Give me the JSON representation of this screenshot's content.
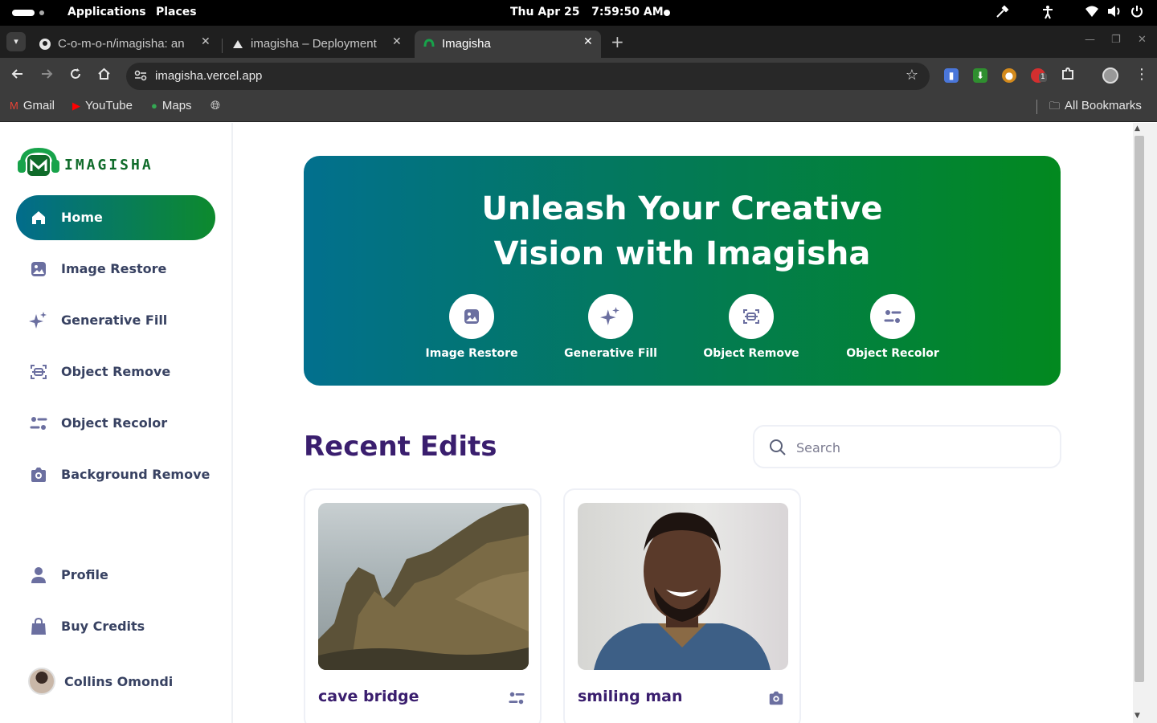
{
  "system_bar": {
    "applications": "Applications",
    "places": "Places",
    "datetime": "Thu Apr 25   7:59:50 AM"
  },
  "browser": {
    "tabs": [
      {
        "title": "C-o-m-o-n/imagisha: an",
        "active": false
      },
      {
        "title": "imagisha – Deployment O",
        "active": false
      },
      {
        "title": "Imagisha",
        "active": true
      }
    ],
    "url": "imagisha.vercel.app",
    "extension_badge": "1",
    "bookmarks": [
      {
        "label": "Gmail"
      },
      {
        "label": "YouTube"
      },
      {
        "label": "Maps"
      }
    ],
    "all_bookmarks": "All Bookmarks"
  },
  "colors": {
    "brand_gradient_start": "#026c8c",
    "brand_gradient_end": "#0d8a2d",
    "heading_purple": "#3a1e6e",
    "nav_text": "#384262"
  },
  "sidebar": {
    "logo_text": "IMAGISHA",
    "items": [
      {
        "label": "Home",
        "icon": "home-icon",
        "active": true
      },
      {
        "label": "Image Restore",
        "icon": "image-icon"
      },
      {
        "label": "Generative Fill",
        "icon": "sparkles-icon"
      },
      {
        "label": "Object Remove",
        "icon": "scan-icon"
      },
      {
        "label": "Object Recolor",
        "icon": "filter-icon"
      },
      {
        "label": "Background Remove",
        "icon": "camera-icon"
      }
    ],
    "bottom_items": [
      {
        "label": "Profile",
        "icon": "user-icon"
      },
      {
        "label": "Buy Credits",
        "icon": "bag-icon"
      }
    ],
    "user_name": "Collins Omondi"
  },
  "hero": {
    "title_line1": "Unleash Your Creative",
    "title_line2": "Vision with Imagisha",
    "links": [
      {
        "label": "Image Restore",
        "icon": "image-icon"
      },
      {
        "label": "Generative Fill",
        "icon": "sparkles-icon"
      },
      {
        "label": "Object Remove",
        "icon": "scan-icon"
      },
      {
        "label": "Object Recolor",
        "icon": "filter-icon"
      }
    ]
  },
  "recent": {
    "title": "Recent Edits",
    "search_placeholder": "Search",
    "cards": [
      {
        "title": "cave bridge",
        "transformation_icon": "filter-icon"
      },
      {
        "title": "smiling man",
        "transformation_icon": "camera-icon"
      }
    ]
  }
}
